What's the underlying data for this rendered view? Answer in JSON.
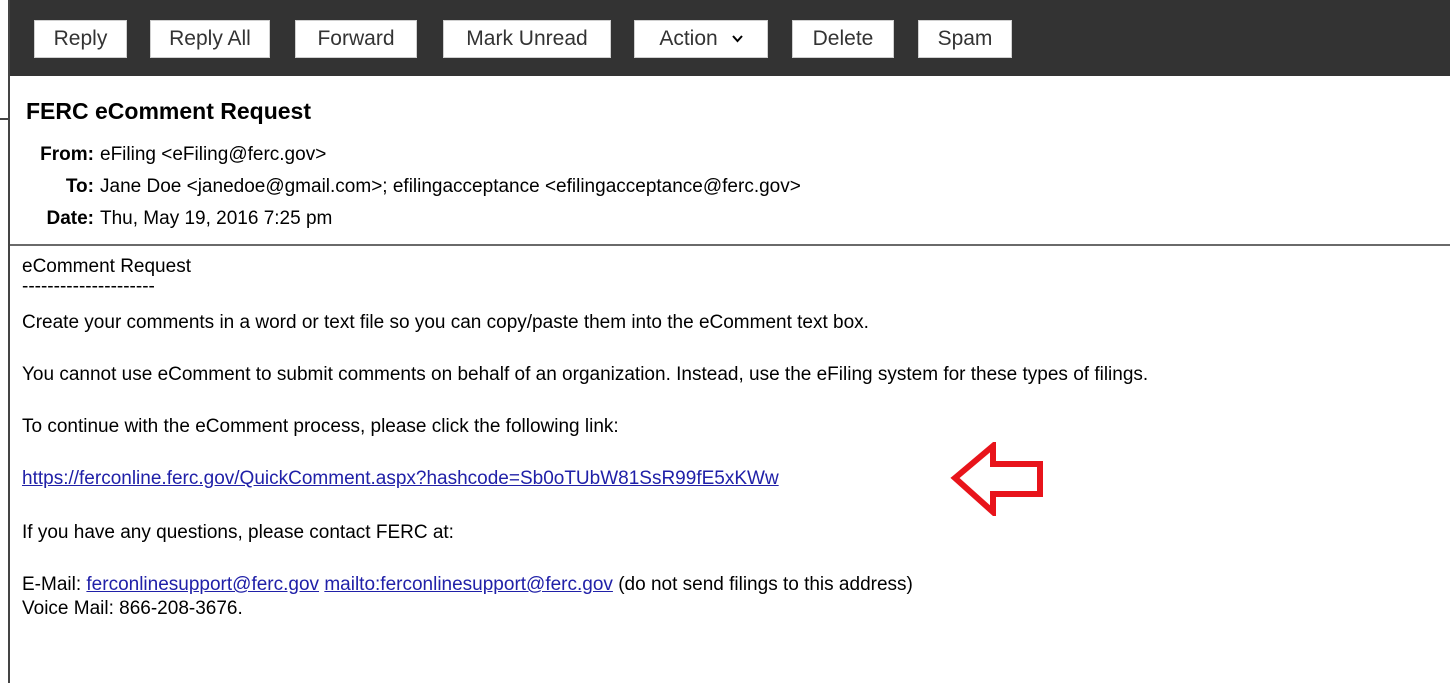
{
  "toolbar": {
    "reply": "Reply",
    "reply_all": "Reply All",
    "forward": "Forward",
    "mark_unread": "Mark Unread",
    "action": "Action",
    "delete": "Delete",
    "spam": "Spam"
  },
  "message": {
    "subject": "FERC eComment Request",
    "from_label": "From:",
    "from_value": "eFiling <eFiling@ferc.gov>",
    "to_label": "To:",
    "to_value": "Jane Doe <janedoe@gmail.com>;  efilingacceptance <efilingacceptance@ferc.gov>",
    "date_label": "Date:",
    "date_value": "Thu, May 19, 2016 7:25 pm"
  },
  "body": {
    "heading": "eComment Request",
    "separator": "---------------------",
    "line1": "Create your comments in a word or text file so you can copy/paste them into the eComment text box.",
    "line2": "You cannot use eComment to submit comments on behalf of an organization. Instead, use the eFiling system for these types of filings.",
    "line3": "To continue with the eComment process, please click the following link:",
    "link": "https://ferconline.ferc.gov/QuickComment.aspx?hashcode=Sb0oTUbW81SsR99fE5xKWw",
    "line4": "If you have any questions, please contact FERC at:",
    "email_label": "E-Mail: ",
    "email_link1": "ferconlinesupport@ferc.gov",
    "email_link2": "mailto:ferconlinesupport@ferc.gov",
    "email_note": " (do not send filings to this address)",
    "voicemail": "Voice Mail: 866-208-3676."
  },
  "colors": {
    "toolbar_bg": "#333333",
    "link": "#2020a8",
    "arrow": "#e8141b"
  },
  "icons": {
    "action_caret": "chevron-down-icon",
    "annotation": "left-arrow-icon"
  }
}
